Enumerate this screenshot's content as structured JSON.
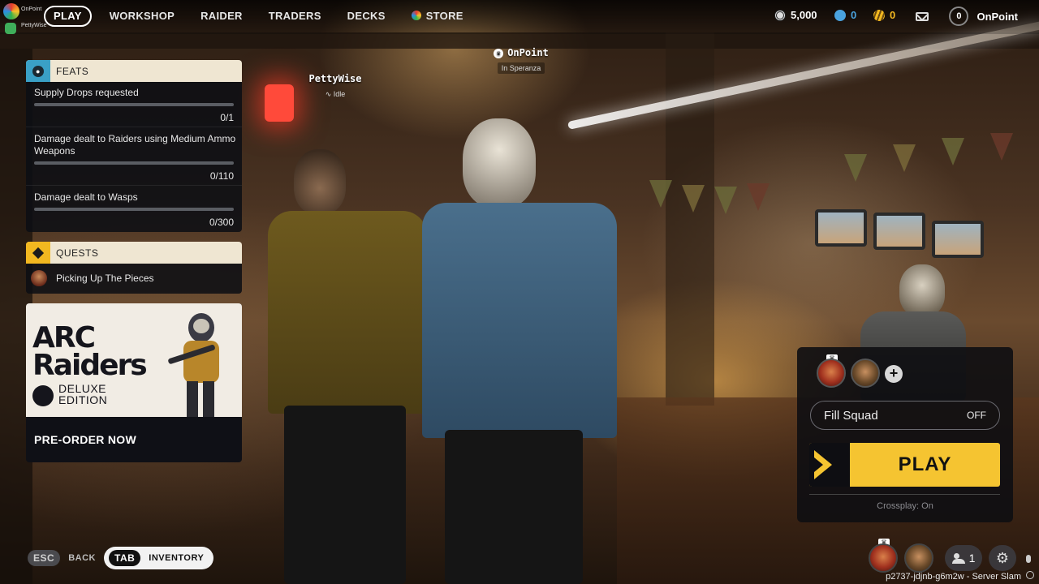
{
  "corner": {
    "user_name": "OnPoint",
    "squad_member": "PettyWise"
  },
  "nav": {
    "items": [
      {
        "label": "PLAY",
        "active": true
      },
      {
        "label": "WORKSHOP"
      },
      {
        "label": "RAIDER"
      },
      {
        "label": "TRADERS"
      },
      {
        "label": "DECKS"
      },
      {
        "label": "STORE",
        "icon": "store-logo-icon"
      }
    ]
  },
  "currencies": [
    {
      "icon": "coins-icon",
      "value": "5,000",
      "color": "#dddddd"
    },
    {
      "icon": "raider-tokens-icon",
      "value": "0",
      "color": "#4aa3df"
    },
    {
      "icon": "credits-icon",
      "value": "0",
      "color": "#f2b820"
    }
  ],
  "profile": {
    "level": "0",
    "name": "OnPoint"
  },
  "feats": {
    "title": "FEATS",
    "items": [
      {
        "name": "Supply Drops requested",
        "progress": "0/1",
        "fraction": 0
      },
      {
        "name": "Damage dealt to Raiders using Medium Ammo Weapons",
        "progress": "0/110",
        "fraction": 0
      },
      {
        "name": "Damage dealt to Wasps",
        "progress": "0/300",
        "fraction": 0
      }
    ]
  },
  "quests": {
    "title": "QUESTS",
    "items": [
      {
        "name": "Picking Up The Pieces"
      }
    ]
  },
  "promo": {
    "title_line1": "ARC",
    "title_line2": "Raiders",
    "edition_line1": "DELUXE",
    "edition_line2": "EDITION",
    "cta": "PRE-ORDER NOW"
  },
  "players": [
    {
      "name": "OnPoint",
      "status": "In Speranza",
      "leader": true
    },
    {
      "name": "PettyWise",
      "status": "Idle",
      "leader": false
    }
  ],
  "squad": {
    "fill_label": "Fill Squad",
    "fill_value": "OFF",
    "play_label": "PLAY",
    "crossplay": "Crossplay: On",
    "accent": "#f5c431"
  },
  "hints": {
    "back_key": "ESC",
    "back_label": "BACK",
    "inventory_key": "TAB",
    "inventory_label": "INVENTORY"
  },
  "friends_count": "1",
  "server_id": "p2737-jdjnb-g6m2w - Server Slam"
}
